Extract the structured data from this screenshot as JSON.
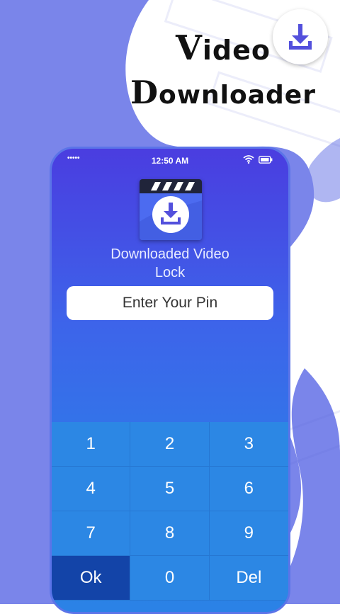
{
  "header": {
    "title_line1_cap": "V",
    "title_line1_rest": "ideo",
    "title_line2_cap": "D",
    "title_line2_rest": "ownloader",
    "badge_icon": "download-icon"
  },
  "status_bar": {
    "signal": "•••••",
    "time": "12:50 AM",
    "wifi_icon": "wifi-icon",
    "battery_icon": "battery-icon"
  },
  "app": {
    "icon": "clapperboard-download-icon",
    "name_line1": "Downloaded Video",
    "name_line2": "Lock"
  },
  "pin": {
    "placeholder": "Enter Your Pin",
    "value": ""
  },
  "keypad": {
    "keys": [
      "1",
      "2",
      "3",
      "4",
      "5",
      "6",
      "7",
      "8",
      "9",
      "Ok",
      "0",
      "Del"
    ]
  },
  "colors": {
    "accent_dark": "#5350dc",
    "accent_blue": "#2c87e4",
    "ok_key": "#1344a8",
    "blob": "#7a85ea"
  }
}
